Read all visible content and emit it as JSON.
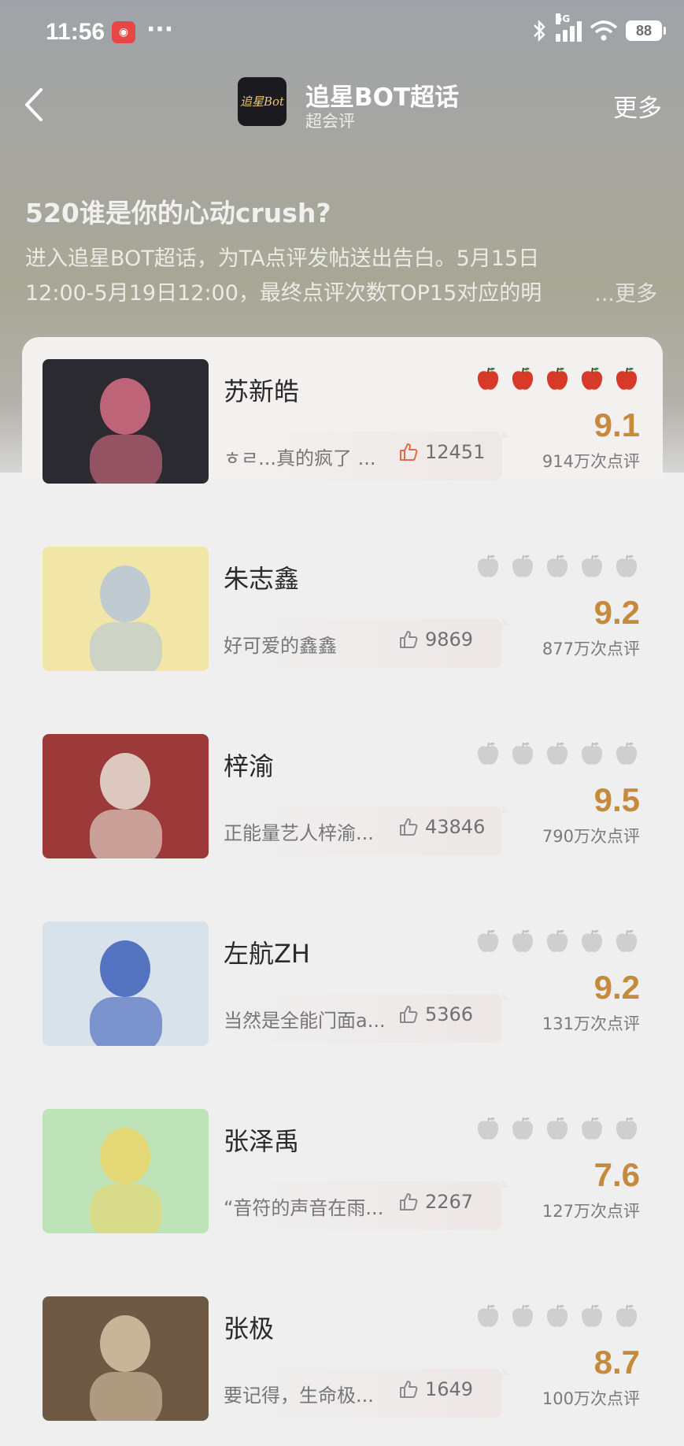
{
  "status_bar": {
    "time": "11:56",
    "app_icon": "app-notification-icon",
    "dots": "···",
    "network": "5G",
    "battery": "88"
  },
  "nav": {
    "title": "追星BOT超话",
    "subtitle": "超会评",
    "more": "更多",
    "logo_text": "追星Bot"
  },
  "header": {
    "headline": "520谁是你的心动crush?",
    "desc_line1": "进入追星BOT超话，为TA点评发帖送出告白。5月15日",
    "desc_line2": "12:00-5月19日12:00，最终点评次数TOP15对应的明",
    "desc_more": "...更多"
  },
  "items": [
    {
      "name": "苏新皓",
      "review": "ㅎㄹ...真的疯了 ...",
      "likes": "12451",
      "score": "9.1",
      "count": "914万次点评",
      "apples_active": 5,
      "like_color": "#e06a4a",
      "thumb_bg": "#2b2a30",
      "thumb_accent": "#d86f86"
    },
    {
      "name": "朱志鑫",
      "review": "好可爱的鑫鑫",
      "likes": "9869",
      "score": "9.2",
      "count": "877万次点评",
      "apples_active": 0,
      "like_color": "#8a8a8a",
      "thumb_bg": "#f1e6a8",
      "thumb_accent": "#b6c6d8"
    },
    {
      "name": "梓渝",
      "review": "正能量艺人梓渝...",
      "likes": "43846",
      "score": "9.5",
      "count": "790万次点评",
      "apples_active": 0,
      "like_color": "#8a8a8a",
      "thumb_bg": "#9c3a3a",
      "thumb_accent": "#e8e2d6"
    },
    {
      "name": "左航ZH",
      "review": "当然是全能门面a...",
      "likes": "5366",
      "score": "9.2",
      "count": "131万次点评",
      "apples_active": 0,
      "like_color": "#8a8a8a",
      "thumb_bg": "#d7e2ea",
      "thumb_accent": "#3d5fb8"
    },
    {
      "name": "张泽禹",
      "review": "“音符的声音在雨...",
      "likes": "2267",
      "score": "7.6",
      "count": "127万次点评",
      "apples_active": 0,
      "like_color": "#8a8a8a",
      "thumb_bg": "#bfe3b8",
      "thumb_accent": "#e9d56a"
    },
    {
      "name": "张极",
      "review": "要记得，生命极...",
      "likes": "1649",
      "score": "8.7",
      "count": "100万次点评",
      "apples_active": 0,
      "like_color": "#8a8a8a",
      "thumb_bg": "#6e5a44",
      "thumb_accent": "#d8c6a6"
    }
  ]
}
